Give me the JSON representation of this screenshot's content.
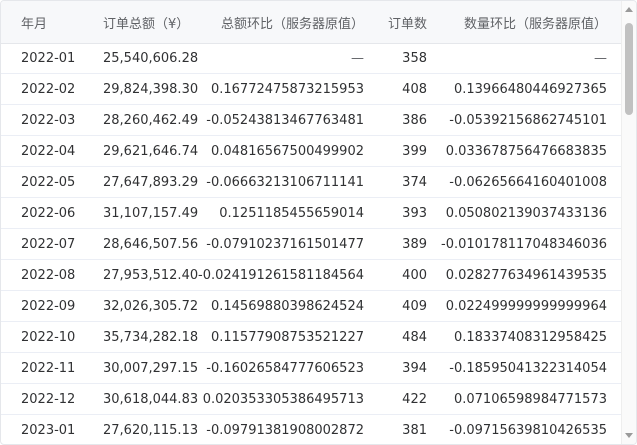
{
  "table": {
    "headers": [
      "年月",
      "订单总额（¥）",
      "总额环比（服务器原值）",
      "订单数",
      "数量环比（服务器原值）"
    ],
    "rows": [
      [
        "2022-01",
        "25,540,606.28",
        "—",
        "358",
        "—"
      ],
      [
        "2022-02",
        "29,824,398.30",
        "0.16772475873215953",
        "408",
        "0.13966480446927365"
      ],
      [
        "2022-03",
        "28,260,462.49",
        "-0.05243813467763481",
        "386",
        "-0.05392156862745101"
      ],
      [
        "2022-04",
        "29,621,646.74",
        "0.04816567500499902",
        "399",
        "0.033678756476683835"
      ],
      [
        "2022-05",
        "27,647,893.29",
        "-0.06663213106711141",
        "374",
        "-0.06265664160401008"
      ],
      [
        "2022-06",
        "31,107,157.49",
        "0.1251185455659014",
        "393",
        "0.050802139037433136"
      ],
      [
        "2022-07",
        "28,646,507.56",
        "-0.07910237161501477",
        "389",
        "-0.010178117048346036"
      ],
      [
        "2022-08",
        "27,953,512.40",
        "-0.024191261581184564",
        "400",
        "0.028277634961439535"
      ],
      [
        "2022-09",
        "32,026,305.72",
        "0.14569880398624524",
        "409",
        "0.022499999999999964"
      ],
      [
        "2022-10",
        "35,734,282.18",
        "0.11577908753521227",
        "484",
        "0.18337408312958425"
      ],
      [
        "2022-11",
        "30,007,297.15",
        "-0.16026584777606523",
        "394",
        "-0.18595041322314054"
      ],
      [
        "2022-12",
        "30,618,044.83",
        "0.020353305386495713",
        "422",
        "0.07106598984771573"
      ],
      [
        "2023-01",
        "27,620,115.13",
        "-0.09791381908002872",
        "381",
        "-0.09715639810426535"
      ]
    ]
  },
  "icons": {
    "scroll_up": "triangle-up-icon",
    "scroll_down": "triangle-down-icon"
  },
  "colors": {
    "header_bg": "#f7f8fa",
    "text": "#303133",
    "header_text": "#606266",
    "row_border": "#ebeef5"
  }
}
